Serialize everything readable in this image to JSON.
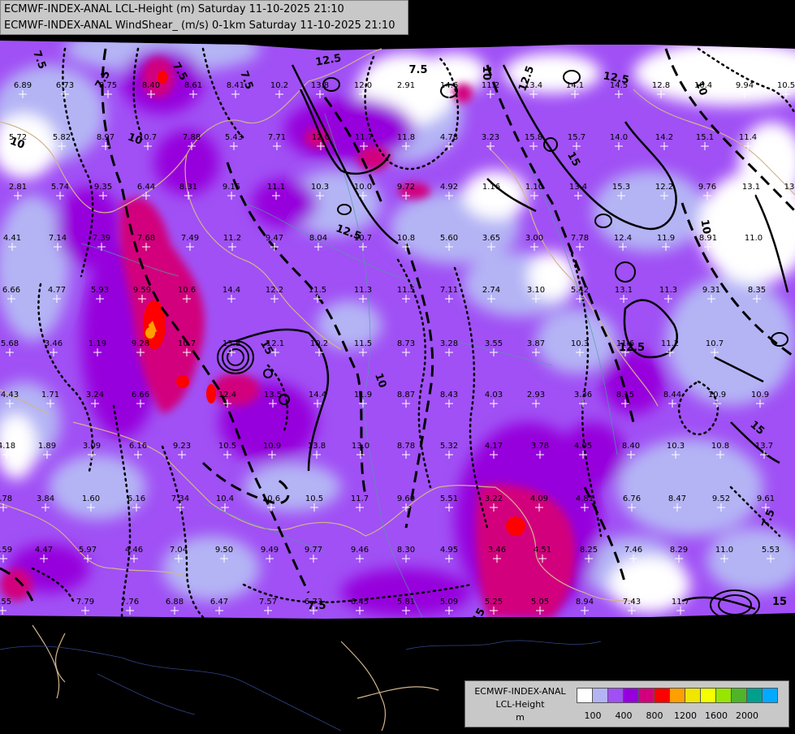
{
  "header": {
    "line1": "ECMWF-INDEX-ANAL LCL-Height (m) Saturday 11-10-2025 21:10",
    "line2": "ECMWF-INDEX-ANAL WindShear_ (m/s) 0-1km Saturday 11-10-2025 21:10"
  },
  "legend": {
    "title1": "ECMWF-INDEX-ANAL",
    "title2": "LCL-Height",
    "unit": "m",
    "colors": [
      "#ffffff",
      "#b4b4f5",
      "#a050f5",
      "#9600dc",
      "#d2007d",
      "#ff0000",
      "#ffa000",
      "#f0e600",
      "#f5ff00",
      "#96e600",
      "#50b428",
      "#00a08c",
      "#00aaff"
    ],
    "ticks": [
      "100",
      "400",
      "800",
      "1200",
      "1600",
      "2000"
    ]
  },
  "map": {
    "contour_labels": [
      "7.5",
      "7.5",
      "7.5",
      "7.5",
      "7.5",
      "7.5",
      "7.5",
      "10",
      "10",
      "10",
      "10",
      "10",
      "10",
      "12.5",
      "12.5",
      "12.5",
      "12.5",
      "12.5",
      "15",
      "15",
      "15",
      "15",
      "15"
    ],
    "station_values": [
      {
        "v": "6.89"
      },
      {
        "v": "6.73"
      },
      {
        "v": "8.75"
      },
      {
        "v": "8.40"
      },
      {
        "v": "8.61"
      },
      {
        "v": "8.41"
      },
      {
        "v": "10.2"
      },
      {
        "v": "13.8"
      },
      {
        "v": "12.0"
      },
      {
        "v": "2.91"
      },
      {
        "v": "14.6"
      },
      {
        "v": "11.2"
      },
      {
        "v": "13.4"
      },
      {
        "v": "14.1"
      },
      {
        "v": "14.5"
      },
      {
        "v": "12.8"
      },
      {
        "v": "10.4"
      },
      {
        "v": "9.94"
      },
      {
        "v": "10.5"
      },
      {
        "v": "5.72"
      },
      {
        "v": "5.82"
      },
      {
        "v": "8.97"
      },
      {
        "v": "10.7"
      },
      {
        "v": "7.88"
      },
      {
        "v": "5.43"
      },
      {
        "v": "7.71"
      },
      {
        "v": "12.0"
      },
      {
        "v": "11.7"
      },
      {
        "v": "11.8"
      },
      {
        "v": "4.78"
      },
      {
        "v": "3.23"
      },
      {
        "v": "15.8"
      },
      {
        "v": "15.7"
      },
      {
        "v": "14.0"
      },
      {
        "v": "14.2"
      },
      {
        "v": "15.1"
      },
      {
        "v": "11.4"
      },
      {
        "v": "2.81"
      },
      {
        "v": "5.74"
      },
      {
        "v": "9.35"
      },
      {
        "v": "6.44"
      },
      {
        "v": "8.31"
      },
      {
        "v": "9.15"
      },
      {
        "v": "11.1"
      },
      {
        "v": "10.3"
      },
      {
        "v": "10.0"
      },
      {
        "v": "9.72"
      },
      {
        "v": "4.92"
      },
      {
        "v": "1.16"
      },
      {
        "v": "1.10"
      },
      {
        "v": "13.4"
      },
      {
        "v": "15.3"
      },
      {
        "v": "12.2"
      },
      {
        "v": "9.76"
      },
      {
        "v": "13.1"
      },
      {
        "v": "13"
      },
      {
        "v": "4.41"
      },
      {
        "v": "7.14"
      },
      {
        "v": "7.39"
      },
      {
        "v": "7.68"
      },
      {
        "v": "7.49"
      },
      {
        "v": "11.2"
      },
      {
        "v": "9.47"
      },
      {
        "v": "8.04"
      },
      {
        "v": "10.7"
      },
      {
        "v": "10.8"
      },
      {
        "v": "5.60"
      },
      {
        "v": "3.65"
      },
      {
        "v": "3.00"
      },
      {
        "v": "7.78"
      },
      {
        "v": "12.4"
      },
      {
        "v": "11.9"
      },
      {
        "v": "8.91"
      },
      {
        "v": "11.0"
      },
      {
        "v": "6.66"
      },
      {
        "v": "4.77"
      },
      {
        "v": "5.93"
      },
      {
        "v": "9.59"
      },
      {
        "v": "10.6"
      },
      {
        "v": "14.4"
      },
      {
        "v": "12.2"
      },
      {
        "v": "11.5"
      },
      {
        "v": "11.3"
      },
      {
        "v": "11.5"
      },
      {
        "v": "7.11"
      },
      {
        "v": "2.74"
      },
      {
        "v": "3.10"
      },
      {
        "v": "5.42"
      },
      {
        "v": "13.1"
      },
      {
        "v": "11.3"
      },
      {
        "v": "9.31"
      },
      {
        "v": "8.35"
      },
      {
        "v": "5.68"
      },
      {
        "v": "3.46"
      },
      {
        "v": "1.19"
      },
      {
        "v": "9.28"
      },
      {
        "v": "10.7"
      },
      {
        "v": "13.8"
      },
      {
        "v": "12.1"
      },
      {
        "v": "10.2"
      },
      {
        "v": "11.5"
      },
      {
        "v": "8.73"
      },
      {
        "v": "3.28"
      },
      {
        "v": "3.55"
      },
      {
        "v": "3.87"
      },
      {
        "v": "10.3"
      },
      {
        "v": "11.6"
      },
      {
        "v": "11.2"
      },
      {
        "v": "10.7"
      },
      {
        "v": "4.43"
      },
      {
        "v": "1.71"
      },
      {
        "v": "3.24"
      },
      {
        "v": "6.66"
      },
      {
        "v": "12.4"
      },
      {
        "v": "13.5"
      },
      {
        "v": "14.4"
      },
      {
        "v": "11.9"
      },
      {
        "v": "8.87"
      },
      {
        "v": "8.43"
      },
      {
        "v": "4.03"
      },
      {
        "v": "2.93"
      },
      {
        "v": "3.36"
      },
      {
        "v": "8.15"
      },
      {
        "v": "8.44"
      },
      {
        "v": "10.9"
      },
      {
        "v": "10.9"
      },
      {
        "v": "4.18"
      },
      {
        "v": "1.89"
      },
      {
        "v": "3.09"
      },
      {
        "v": "6.16"
      },
      {
        "v": "9.23"
      },
      {
        "v": "10.5"
      },
      {
        "v": "10.9"
      },
      {
        "v": "13.8"
      },
      {
        "v": "13.0"
      },
      {
        "v": "8.78"
      },
      {
        "v": "5.32"
      },
      {
        "v": "4.17"
      },
      {
        "v": "3.78"
      },
      {
        "v": "4.05"
      },
      {
        "v": "8.40"
      },
      {
        "v": "10.3"
      },
      {
        "v": "10.8"
      },
      {
        "v": "13.7"
      },
      {
        "v": "3.78"
      },
      {
        "v": "3.84"
      },
      {
        "v": "1.60"
      },
      {
        "v": "6.16"
      },
      {
        "v": "7.34"
      },
      {
        "v": "10.4"
      },
      {
        "v": "10.6"
      },
      {
        "v": "10.5"
      },
      {
        "v": "11.7"
      },
      {
        "v": "9.69"
      },
      {
        "v": "5.51"
      },
      {
        "v": "3.22"
      },
      {
        "v": "4.09"
      },
      {
        "v": "4.81"
      },
      {
        "v": "6.76"
      },
      {
        "v": "8.47"
      },
      {
        "v": "9.52"
      },
      {
        "v": "9.61"
      },
      {
        "v": "5.59"
      },
      {
        "v": "4.47"
      },
      {
        "v": "5.97"
      },
      {
        "v": "4.46"
      },
      {
        "v": "7.04"
      },
      {
        "v": "9.50"
      },
      {
        "v": "9.49"
      },
      {
        "v": "9.77"
      },
      {
        "v": "9.46"
      },
      {
        "v": "8.30"
      },
      {
        "v": "4.95"
      },
      {
        "v": "3.46"
      },
      {
        "v": "4.51"
      },
      {
        "v": "8.25"
      },
      {
        "v": "7.46"
      },
      {
        "v": "8.29"
      },
      {
        "v": "11.0"
      },
      {
        "v": "5.53"
      },
      {
        "v": "4.55"
      },
      {
        "v": "7.79"
      },
      {
        "v": "7.76"
      },
      {
        "v": "6.88"
      },
      {
        "v": "6.47"
      },
      {
        "v": "7.57"
      },
      {
        "v": "6.73"
      },
      {
        "v": "6.45"
      },
      {
        "v": "5.81"
      },
      {
        "v": "5.09"
      },
      {
        "v": "5.25"
      },
      {
        "v": "5.05"
      },
      {
        "v": "8.94"
      },
      {
        "v": "7.43"
      },
      {
        "v": "11.7"
      }
    ]
  }
}
